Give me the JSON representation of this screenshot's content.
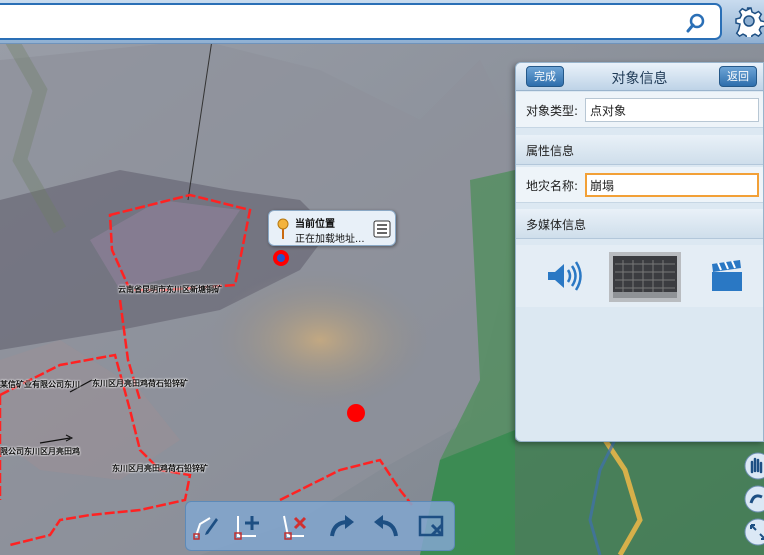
{
  "search": {
    "placeholder": "",
    "value": ""
  },
  "icons": {
    "search": "search-icon",
    "settings": "gear-icon",
    "location": "location-pin-icon",
    "detail": "list-detail-icon",
    "audio": "speaker-icon",
    "photo": "photo-thumbnail",
    "video": "video-clapper-icon"
  },
  "callout": {
    "title": "当前位置",
    "subtitle": "正在加载地址..."
  },
  "map_labels": {
    "l1": "云南省昆明市东川区新塘铜矿",
    "l2": "某信矿业有限公司东川",
    "l3": "东川区月亮田鸡荷石铅锌矿",
    "l4": "东川区月亮田鸡荷石铅锌矿",
    "l5": "限公司东川区月亮田鸡"
  },
  "panel": {
    "done_label": "完成",
    "title": "对象信息",
    "back_label": "返回",
    "type_label": "对象类型:",
    "type_value": "点对象",
    "attr_section": "属性信息",
    "name_label": "地灾名称:",
    "name_value": "崩塌",
    "media_section": "多媒体信息"
  },
  "colors": {
    "boundary": "#ff2222",
    "marker": "#ff0000",
    "accent": "#2e6eac",
    "active_border": "#f2a037"
  },
  "toolbar": [
    "edit-point-icon",
    "add-point-icon",
    "delete-point-icon",
    "redo-icon",
    "undo-icon",
    "clear-icon"
  ],
  "side_buttons": [
    "hand-pan-icon",
    "hand-pan-alt-icon",
    "fullscreen-icon"
  ]
}
